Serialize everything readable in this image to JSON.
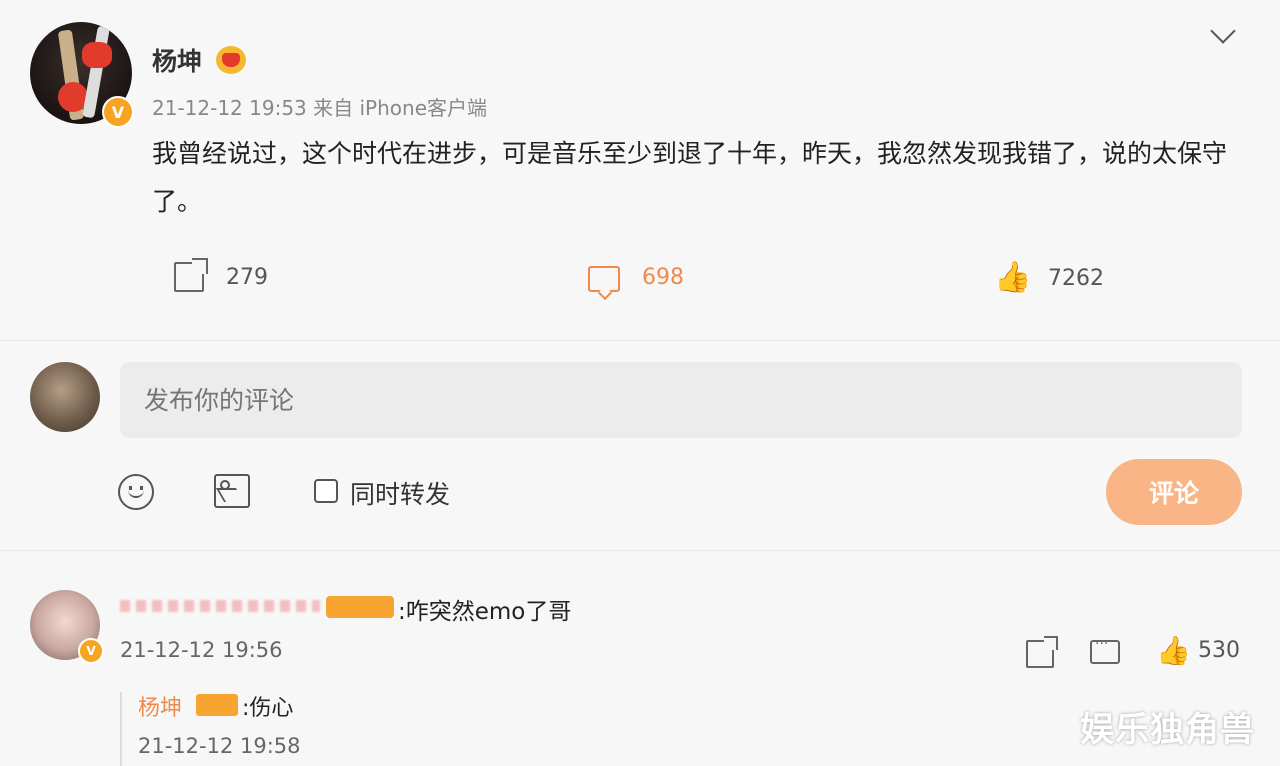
{
  "post": {
    "username": "杨坤",
    "verified_mark": "V",
    "timestamp": "21-12-12 19:53",
    "source": "来自 iPhone客户端",
    "text": "我曾经说过，这个时代在进步，可是音乐至少到退了十年，昨天，我忽然发现我错了，说的太保守了。",
    "shares": "279",
    "comments": "698",
    "likes": "7262"
  },
  "composer": {
    "placeholder": "发布你的评论",
    "repost_label": "同时转发",
    "submit_label": "评论"
  },
  "comment": {
    "text": ":咋突然emo了哥",
    "time": "21-12-12 19:56",
    "likes": "530",
    "reply": {
      "name": "杨坤",
      "text": ":伤心",
      "time": "21-12-12 19:58"
    }
  },
  "watermark": "娱乐独角兽",
  "colors": {
    "accent": "#f08a4b",
    "button": "#f9b585",
    "badge": "#f7a530"
  }
}
